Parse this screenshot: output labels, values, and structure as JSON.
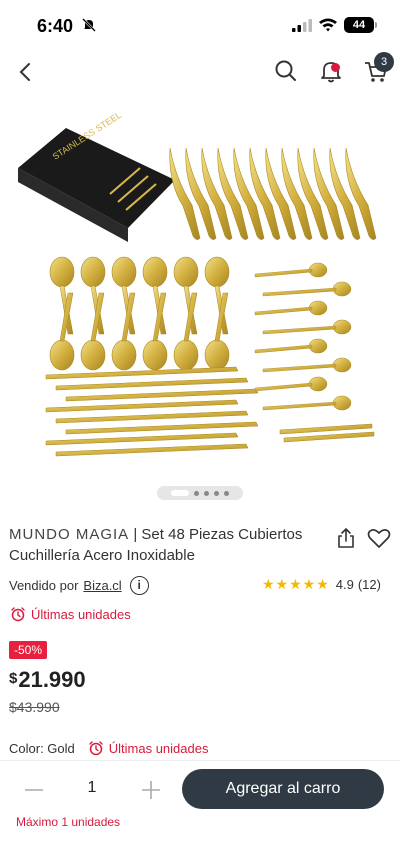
{
  "status_bar": {
    "time": "6:40",
    "battery": "44"
  },
  "header": {
    "cart_count": "3"
  },
  "product": {
    "brand": "MUNDO MAGIA",
    "separator": "|",
    "name": "Set 48 Piezas Cubiertos Cuchillería Acero Inoxidable",
    "box_text": "STAINLESS STEEL",
    "image_count": 5,
    "active_image": 0
  },
  "seller": {
    "label": "Vendido por",
    "name": "Biza.cl"
  },
  "rating": {
    "stars": 5,
    "score": "4.9",
    "count": "(12)"
  },
  "stock": {
    "label": "Últimas unidades"
  },
  "pricing": {
    "discount": "-50%",
    "currency": "$",
    "price": "21.990",
    "old_price": "$43.990"
  },
  "variant": {
    "label": "Color: Gold",
    "stock_label": "Últimas unidades"
  },
  "purchase": {
    "quantity": "1",
    "add_label": "Agregar al carro",
    "max_note": "Máximo 1 unidades"
  },
  "colors": {
    "accent_red": "#d81b3c",
    "dark_button": "#2f3a45",
    "gold": "#d8b94a",
    "star": "#f5b800"
  }
}
